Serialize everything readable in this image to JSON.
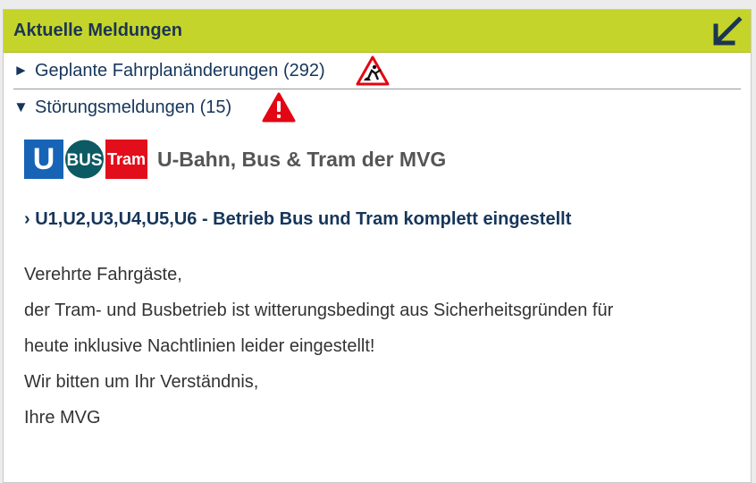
{
  "header": {
    "title": "Aktuelle Meldungen",
    "collapse_icon": "arrow-down-left-icon"
  },
  "sections": [
    {
      "arrow": "►",
      "label": "Geplante Fahrplanänderungen (292)",
      "icon": "construction-warning-icon"
    },
    {
      "arrow": "▼",
      "label": "Störungsmeldungen (15)",
      "icon": "red-warning-icon"
    }
  ],
  "operator": {
    "badge_u": "U",
    "badge_bus": "BUS",
    "badge_tram": "Tram",
    "name": "U-Bahn, Bus & Tram der MVG"
  },
  "alert": {
    "headline": "› U1,U2,U3,U4,U5,U6 - Betrieb Bus und Tram komplett eingestellt",
    "lines": [
      "Verehrte Fahrgäste,",
      "der Tram- und Busbetrieb ist witterungsbedingt aus Sicherheitsgründen für",
      "heute inklusive Nachtlinien leider eingestellt!",
      "Wir bitten um Ihr Verständnis,",
      "Ihre MVG"
    ]
  },
  "colors": {
    "header_bg": "#c5d42a",
    "text_dark_blue": "#16365a",
    "u_blue": "#1763b6",
    "bus_teal": "#0c5a63",
    "tram_red": "#e20e1b",
    "warning_red": "#e30613"
  }
}
